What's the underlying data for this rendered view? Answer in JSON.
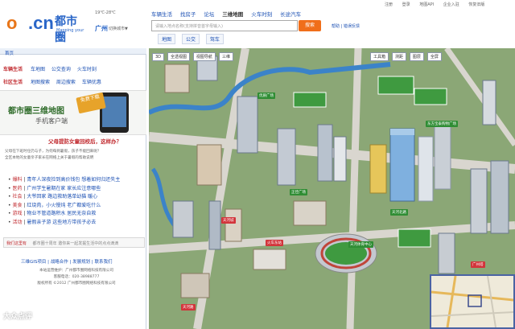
{
  "header": {
    "logo_o": "o",
    "logo_cn": ".cn",
    "logo_name": "都市圈",
    "logo_tagline": "Mapping your life",
    "weather": "19℃-28℃",
    "city": "广州",
    "city_switch": "切换城市▼",
    "top_nav": [
      "车辆生活",
      "找房子",
      "论坛",
      "三维地图",
      "火车时刻",
      "长途汽车"
    ],
    "active_nav_index": 3,
    "search_placeholder": "请输入地点名称(支持拼音首字母输入)",
    "search_button": "搜索",
    "help": "帮助",
    "feedback": "错误反馈",
    "sub_tabs": [
      "地图",
      "公交",
      "驾车"
    ],
    "top_links": [
      "注册",
      "登录",
      "地图API",
      "企业入驻",
      "恢复旧版"
    ]
  },
  "left": {
    "home_tab": "首页",
    "service_rows": [
      {
        "head": "车辆生活",
        "items": [
          "车地图",
          "公交查询",
          "火车时刻"
        ]
      },
      {
        "head": "社区生活",
        "items": [
          "地图搜索",
          "周边搜索",
          "车辆优惠"
        ]
      }
    ],
    "banner_title": "都市圈三维地图",
    "banner_sub": "手机客户端",
    "banner_badge": "免费下载",
    "news_head": "父母提防女童回校后，这样办？",
    "news_intro": [
      "父母在下班时任仍与子，为何每到暑假，孩子不能回来呢？",
      "全区本地的女童亲子家长在网络上关于暑假的帮助说明"
    ],
    "news_items": [
      {
        "cat": "爆料",
        "text": "青年人深夜捡到高价钱包 想着如何归还失主"
      },
      {
        "cat": "医药",
        "text": "广州学生暑期在家 家长应注意哪些"
      },
      {
        "cat": "社会",
        "text": "大爷回家 路边救助落单幼猫 暖心"
      },
      {
        "cat": "美食",
        "text": "红烧肉，小火慢炖 老广都爱吃什么"
      },
      {
        "cat": "游戏",
        "text": "物业不管道路积水 居民无奈自救"
      },
      {
        "cat": "活动",
        "text": "暑假亲子游 这些地方带孩子必去"
      }
    ],
    "msg_label": "我们这里有",
    "msg_text": "都市圈十周年 邀你来一起发掘生活中的点点滴滴",
    "footer_links": [
      "三维GIS项目",
      "战略合作",
      "发展规划",
      "联系我们"
    ],
    "footer_lines": [
      "本站运营维护：广州都市圈网络科技有限公司",
      "客服电话：020-38988777",
      "版权所有 ©2012 广州都市圈网络科技有限公司"
    ]
  },
  "map": {
    "controls": [
      "3D",
      "全透视图",
      "视图导航"
    ],
    "view_label": "三维",
    "tools": [
      "工具箱",
      "测距",
      "图层",
      "全屏"
    ],
    "pois": [
      {
        "label": "优质广场",
        "color": "green"
      },
      {
        "label": "东方宝泰购物广场",
        "color": "green"
      },
      {
        "label": "天河体育中心",
        "color": "green"
      },
      {
        "label": "火车东站",
        "color": "red"
      },
      {
        "label": "天河城",
        "color": "red"
      },
      {
        "label": "正佳广场",
        "color": "green"
      },
      {
        "label": "天河路",
        "color": "red"
      },
      {
        "label": "天河北路",
        "color": "green"
      },
      {
        "label": "广州塔",
        "color": "red"
      }
    ]
  },
  "watermark": "大众点评"
}
